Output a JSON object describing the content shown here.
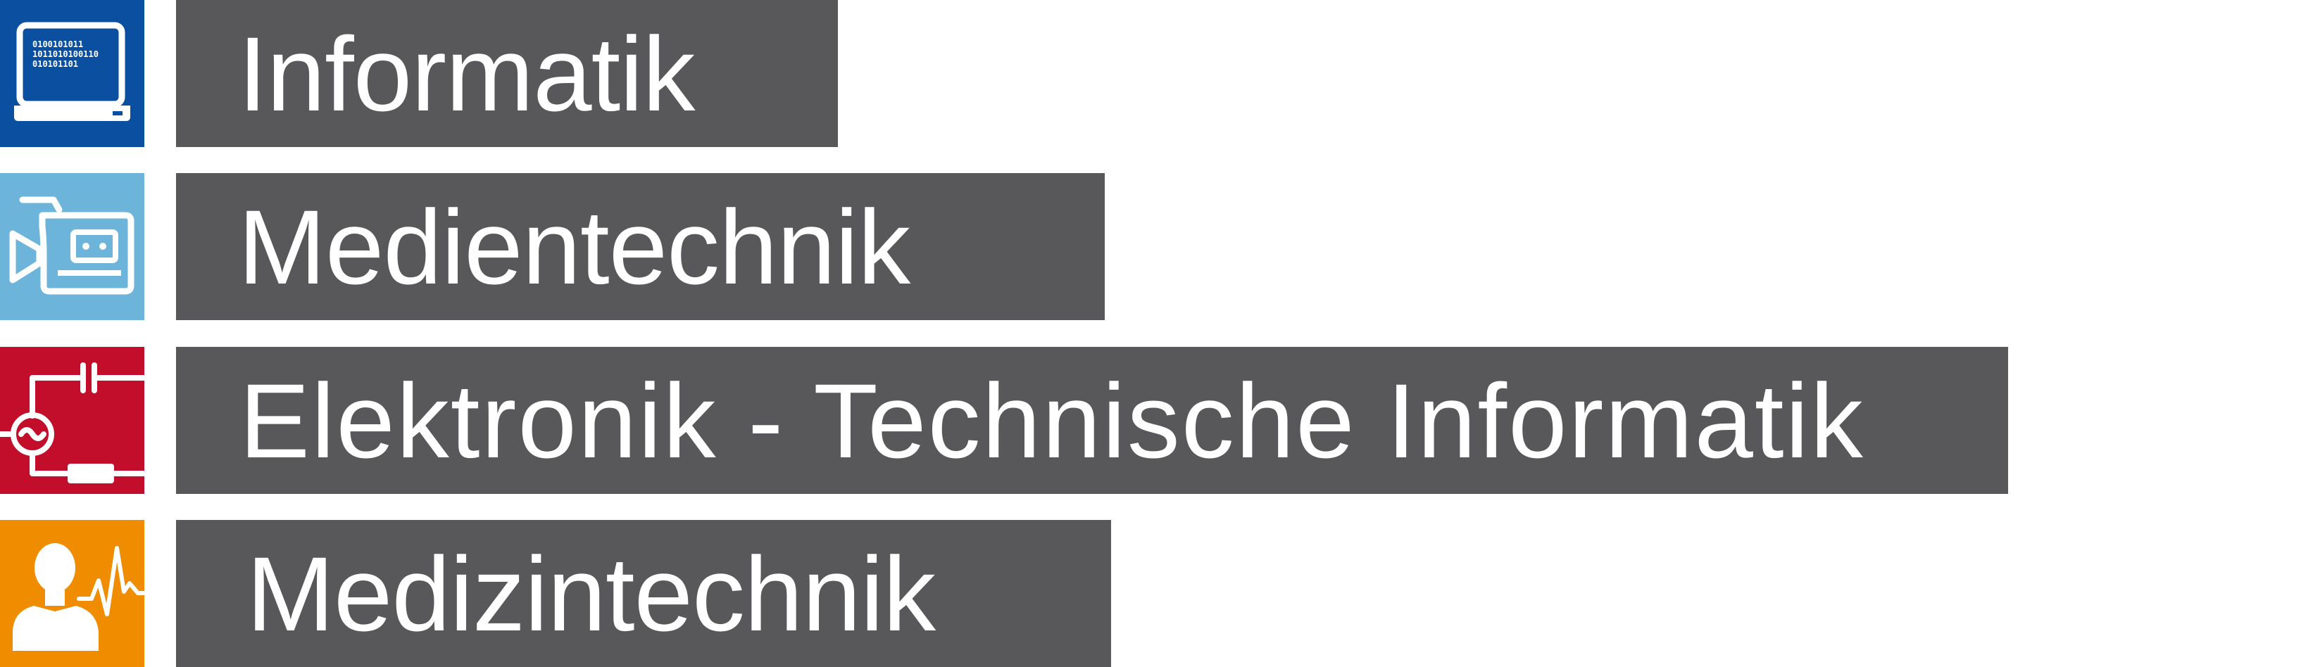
{
  "categories": [
    {
      "label": "Informatik",
      "icon": "laptop-binary-icon",
      "color": "#0b4fa0",
      "binary_lines": [
        "0100101011",
        "1011010100110",
        "010101101"
      ]
    },
    {
      "label": "Medientechnik",
      "icon": "video-camera-icon",
      "color": "#6db4db"
    },
    {
      "label": "Elektronik - Technische Informatik",
      "icon": "circuit-icon",
      "color": "#c20e2b"
    },
    {
      "label": "Medizintechnik",
      "icon": "person-heartbeat-icon",
      "color": "#f08c00"
    }
  ]
}
